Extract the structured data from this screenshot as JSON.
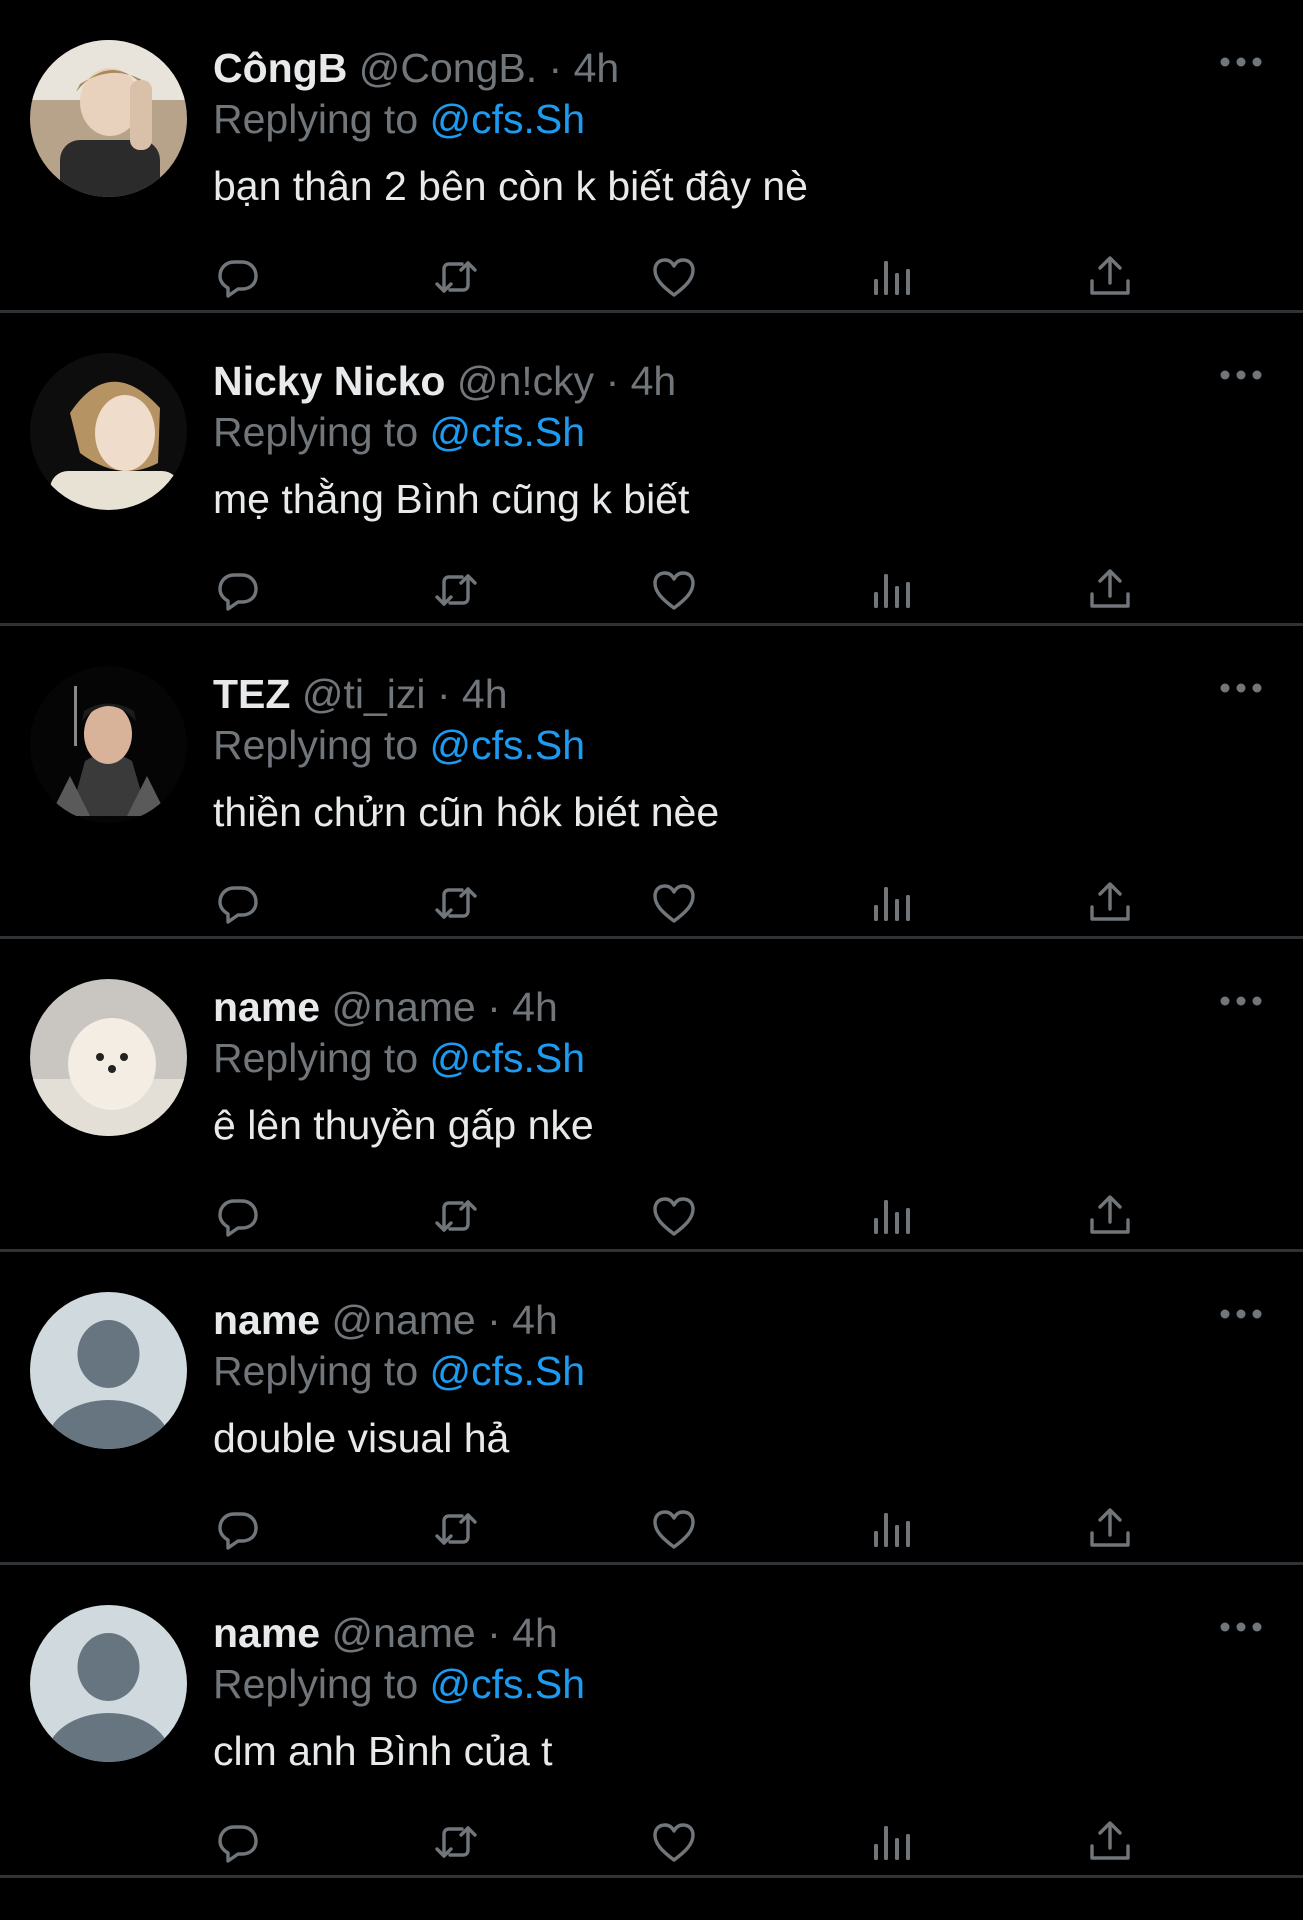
{
  "colors": {
    "background": "#000000",
    "name": "#e7e9ea",
    "muted": "#71767b",
    "link": "#1d9bf0",
    "divider": "#2f3336"
  },
  "icons": [
    "reply-icon",
    "retweet-icon",
    "like-icon",
    "views-icon",
    "share-icon",
    "more-icon"
  ],
  "tweets": [
    {
      "name": "CôngB",
      "handle": "@CongB.",
      "sep": " · ",
      "time": "4h",
      "replying_prefix": "Replying to ",
      "replying_to": "@cfs.Sh",
      "text": "bạn thân 2 bên còn k biết đây nè",
      "avatar": "photo"
    },
    {
      "name": "Nicky Nicko",
      "handle": "@n!cky",
      "sep": " · ",
      "time": "4h",
      "replying_prefix": "Replying to ",
      "replying_to": "@cfs.Sh",
      "text": "mẹ thằng Bình cũng k biết",
      "avatar": "photo"
    },
    {
      "name": "TEZ",
      "handle": "@ti_izi",
      "sep": " · ",
      "time": "4h",
      "replying_prefix": "Replying to ",
      "replying_to": "@cfs.Sh",
      "text": "thiền chửn cũn hôk biét nèe",
      "avatar": "photo"
    },
    {
      "name": "name",
      "handle": "@name",
      "sep": " · ",
      "time": "4h",
      "replying_prefix": "Replying to ",
      "replying_to": "@cfs.Sh",
      "text": "ê lên thuyền gấp nke",
      "avatar": "photo"
    },
    {
      "name": "name",
      "handle": "@name",
      "sep": " · ",
      "time": "4h",
      "replying_prefix": "Replying to ",
      "replying_to": "@cfs.Sh",
      "text": "double visual hả",
      "avatar": "default"
    },
    {
      "name": "name",
      "handle": "@name",
      "sep": " · ",
      "time": "4h",
      "replying_prefix": "Replying to ",
      "replying_to": "@cfs.Sh",
      "text": "clm anh Bình của t",
      "avatar": "default"
    }
  ]
}
